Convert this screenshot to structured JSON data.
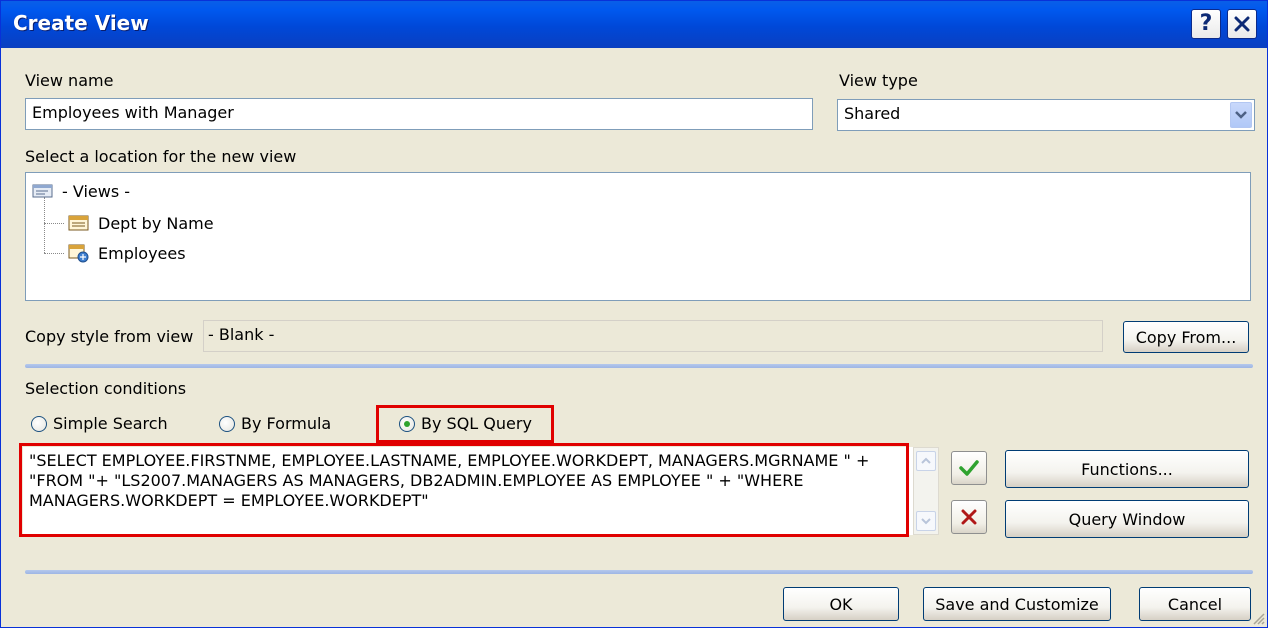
{
  "window": {
    "title": "Create View"
  },
  "titlebar": {
    "help_label": "?",
    "close_label": "✕"
  },
  "view_name": {
    "label": "View name",
    "value": "Employees with Manager"
  },
  "view_type": {
    "label": "View type",
    "value": "Shared"
  },
  "location": {
    "label": "Select a location for the new view",
    "root": "- Views -",
    "items": [
      "Dept by Name",
      "Employees"
    ]
  },
  "copy_style": {
    "label": "Copy style from view",
    "value": "- Blank -",
    "button": "Copy From..."
  },
  "selection": {
    "label": "Selection conditions",
    "options": [
      "Simple Search",
      "By Formula",
      "By SQL Query"
    ],
    "selected": "By SQL Query",
    "query": "\"SELECT EMPLOYEE.FIRSTNME, EMPLOYEE.LASTNAME, EMPLOYEE.WORKDEPT, MANAGERS.MGRNAME \" + \"FROM \"+ \"LS2007.MANAGERS AS MANAGERS, DB2ADMIN.EMPLOYEE AS EMPLOYEE \" + \"WHERE MANAGERS.WORKDEPT = EMPLOYEE.WORKDEPT\""
  },
  "side_buttons": {
    "functions": "Functions...",
    "query_window": "Query Window"
  },
  "footer": {
    "ok": "OK",
    "save_customize": "Save and Customize",
    "cancel": "Cancel"
  },
  "colors": {
    "titlebar": "#0058EE",
    "highlight_border": "#E00000",
    "accept": "#2FA32F",
    "reject": "#B01818"
  }
}
